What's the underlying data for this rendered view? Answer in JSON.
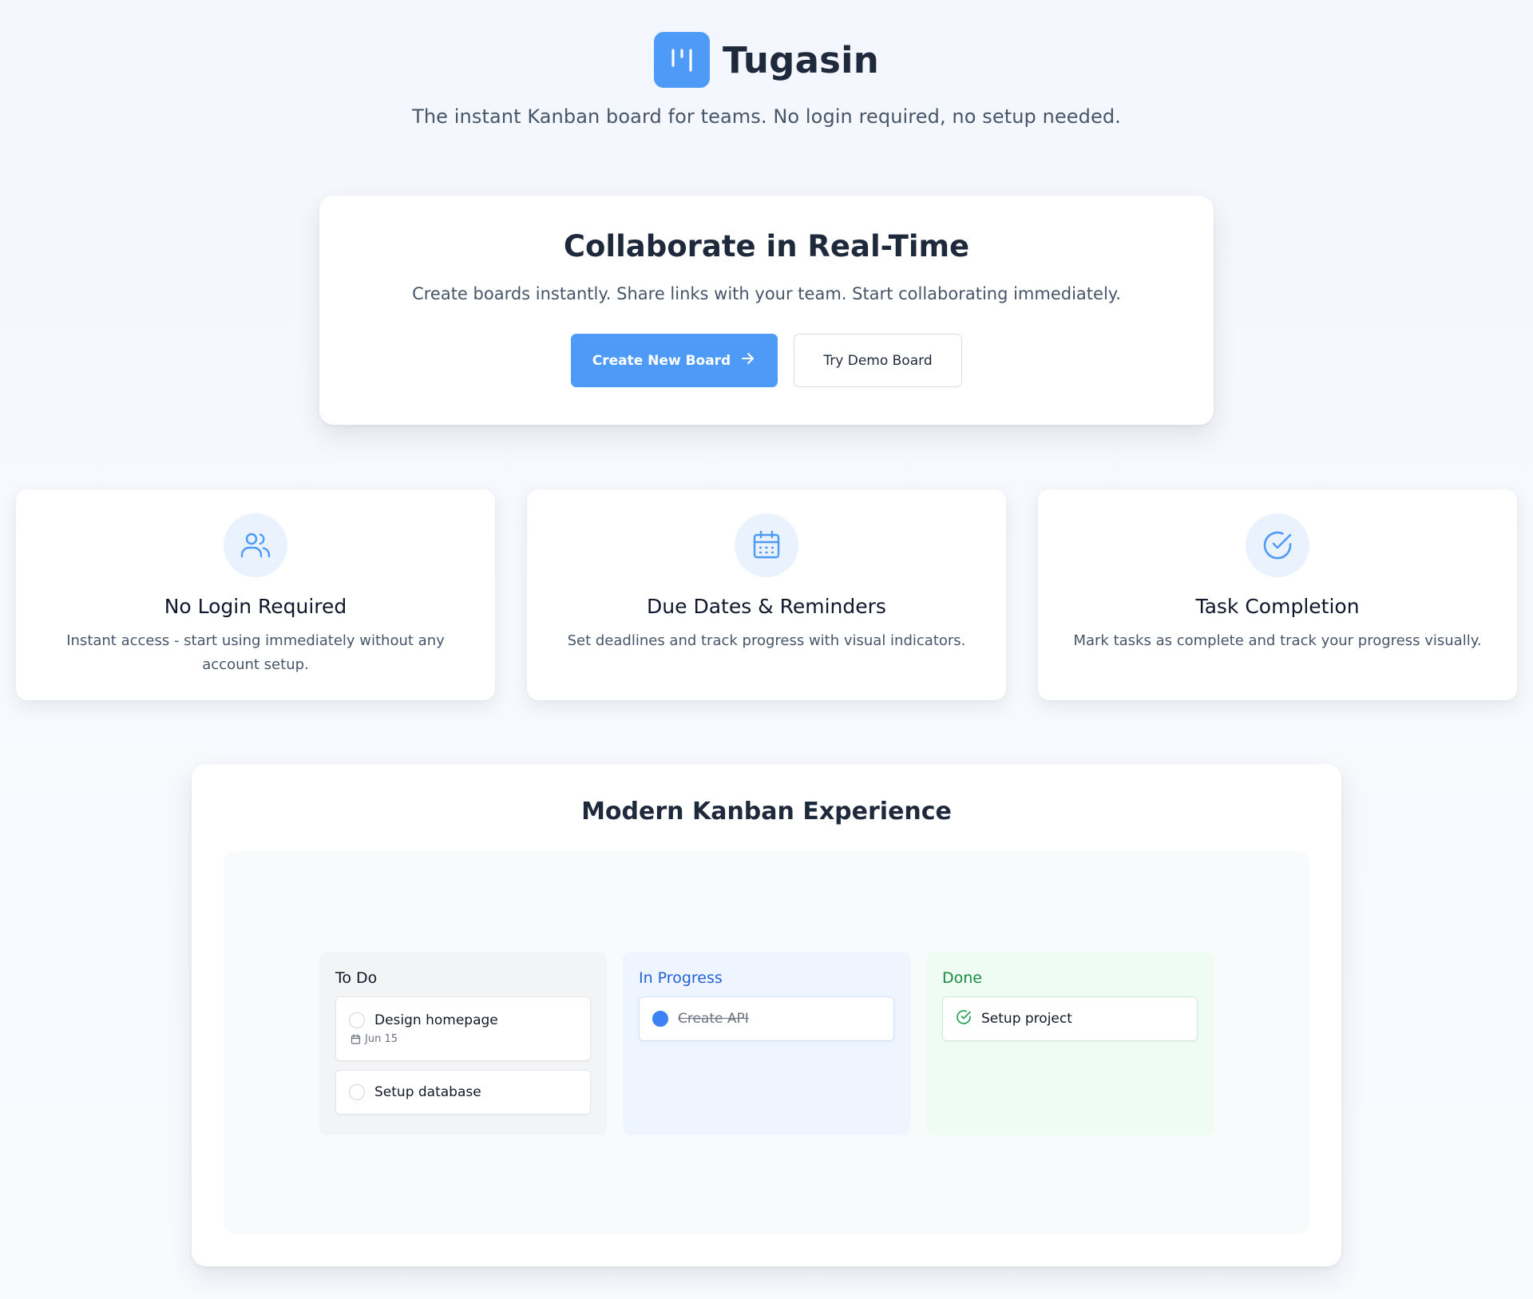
{
  "brand": {
    "name": "Tugasin",
    "logo_icon": "kanban-columns-icon",
    "tagline": "The instant Kanban board for teams. No login required, no setup needed."
  },
  "hero": {
    "title": "Collaborate in Real-Time",
    "subtitle": "Create boards instantly. Share links with your team. Start collaborating immediately.",
    "primary_button": "Create New Board",
    "primary_button_icon": "arrow-right-icon",
    "secondary_button": "Try Demo Board"
  },
  "features": [
    {
      "icon": "users-icon",
      "title": "No Login Required",
      "description": "Instant access - start using immediately without any account setup."
    },
    {
      "icon": "calendar-icon",
      "title": "Due Dates & Reminders",
      "description": "Set deadlines and track progress with visual indicators."
    },
    {
      "icon": "check-circle-icon",
      "title": "Task Completion",
      "description": "Mark tasks as complete and track your progress visually."
    }
  ],
  "preview": {
    "title": "Modern Kanban Experience",
    "columns": [
      {
        "title": "To Do",
        "tasks": [
          {
            "label": "Design homepage",
            "due": "Jun 15",
            "status": "open"
          },
          {
            "label": "Setup database",
            "status": "open"
          }
        ]
      },
      {
        "title": "In Progress",
        "tasks": [
          {
            "label": "Create API",
            "status": "in-progress"
          }
        ]
      },
      {
        "title": "Done",
        "tasks": [
          {
            "label": "Setup project",
            "status": "done"
          }
        ]
      }
    ]
  },
  "colors": {
    "accent": "#4d9af7",
    "heading": "#1e293b",
    "in_progress": "#2461d6",
    "done": "#188a43"
  }
}
